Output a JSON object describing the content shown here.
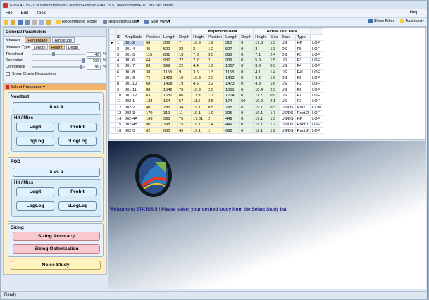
{
  "window": {
    "title": "ESSTATUS - C:\\Users\\mmarvast\\Desktop\\Eclipse\\STATUS 5 Development\\Full Data Set.status"
  },
  "menu": {
    "items": [
      "File",
      "Edit",
      "Tools"
    ],
    "help": "Help"
  },
  "toolbar": {
    "recommend": "Recommend Model",
    "inspection": "Inspection Data",
    "split": "Split View",
    "show_filter": "Show Filter",
    "assistant": "Assistant"
  },
  "general": {
    "title": "General Parameters",
    "measure_label": "Measure",
    "measure_tabs": [
      "Percentage",
      "Amplitude"
    ],
    "measure_type_label": "Measure Type",
    "measure_types": [
      "Length",
      "Height",
      "Depth"
    ],
    "threshold_label": "Threshold",
    "threshold_value": "40",
    "saturation_label": "Saturation",
    "saturation_value": "100",
    "confidence_label": "Confidence",
    "confidence_value": "95",
    "percent": "%",
    "show_charts": "Show Charts Descriptions",
    "threshold_level": 0.4,
    "saturation_level": 1.0,
    "confidence_level": 0.95
  },
  "processor": {
    "header": "Select Processor",
    "nordtest": "Nordtest",
    "ahat": "â vs a",
    "hitmiss": "Hit / Miss",
    "logit": "Logit",
    "probit": "Probit",
    "loglog": "LogLog",
    "cloglog": "cLogLog",
    "pod": "POD",
    "sizing": "Sizing",
    "sizing_accuracy": "Sizing Accuracy",
    "sizing_optimization": "Sizing Optimization",
    "noise": "Noise Study"
  },
  "grid": {
    "group_headers": [
      "Inspection Data",
      "Actual Test Data"
    ],
    "columns": [
      "ID",
      "Amplitude",
      "Position",
      "Length",
      "Depth",
      "Height",
      "Position",
      "Length",
      "Depth",
      "Height",
      "Side",
      "Zone",
      "Type"
    ],
    "rows": [
      [
        "1",
        "J01-2",
        "68",
        "306",
        "7",
        "16.9",
        "1.2",
        "310",
        "0",
        "17.8",
        "1.3",
        "US",
        "HP",
        "LOF"
      ],
      [
        "2",
        "J01-4",
        "45",
        "520",
        "22",
        "3",
        "1.2",
        "527",
        "0",
        "3",
        "1.3",
        "DS",
        "F5",
        "LOF"
      ],
      [
        "3",
        "J01-5",
        "115",
        "881",
        "13",
        "7.8",
        "3.5",
        "888",
        "0",
        "7.1",
        "2.4",
        "DS",
        "F3",
        "LOF"
      ],
      [
        "4",
        "J01-6",
        "64",
        "932",
        "27",
        "7.2",
        "2",
        "939",
        "0",
        "5.9",
        "1.5",
        "US",
        "F3",
        "LOF"
      ],
      [
        "5",
        "J01-7",
        "83",
        "999",
        "22",
        "4.4",
        "1.9",
        "1007",
        "0",
        "3.9",
        "0.3",
        "US",
        "F4",
        "LOF"
      ],
      [
        "6",
        "J01-8",
        "38",
        "1153",
        "9",
        "3.5",
        "1.3",
        "1158",
        "0",
        "4.1",
        "1.4",
        "US",
        "F4U",
        "LOF"
      ],
      [
        "7",
        "J01-9",
        "72",
        "1428",
        "10",
        "10.9",
        "2.5",
        "1433",
        "0",
        "9.2",
        "1.6",
        "DS",
        "F2",
        "LOF"
      ],
      [
        "8",
        "J01-10",
        "68",
        "1468",
        "19",
        "4.5",
        "2.2",
        "1473",
        "0",
        "4.3",
        "1.6",
        "DS",
        "F2",
        "LOF"
      ],
      [
        "9",
        "J01-11",
        "88",
        "1542",
        "76",
        "10.9",
        "2.5",
        "1551",
        "0",
        "10.4",
        "2.3",
        "US",
        "F2",
        "LOF"
      ],
      [
        "10",
        "J01-12",
        "63",
        "1631",
        "86",
        "11.9",
        "1.7",
        "1714",
        "0",
        "11.7",
        "0.9",
        "US",
        "F1",
        "LOF"
      ],
      [
        "11",
        "J02-1",
        "138",
        "164",
        "57",
        "11.6",
        "2.5",
        "174",
        "50",
        "10.9",
        "2.1",
        "US",
        "F2",
        "LOF"
      ],
      [
        "12",
        "J02-2",
        "40",
        "285",
        "34",
        "19.1",
        "0.5",
        "295",
        "0",
        "19.1",
        "0.3",
        "US/DS",
        "RM2",
        "CON"
      ],
      [
        "13",
        "J02-3",
        "170",
        "319",
        "11",
        "19.1",
        "1.9",
        "325",
        "0",
        "19.1",
        "1.7",
        "US/DS",
        "Root 2",
        "LOF"
      ],
      [
        "14",
        "J02-4A",
        "106",
        "398",
        "75",
        "17.01",
        "2",
        "449",
        "0",
        "17.1",
        "1.3",
        "US/DS",
        "HP",
        "LOF"
      ],
      [
        "15",
        "J02-4B",
        "90",
        "398",
        "75",
        "19.1",
        "1.4",
        "449",
        "0",
        "19.1",
        "1.2",
        "US/DS",
        "Root 1",
        "LOF"
      ],
      [
        "16",
        "J02-5",
        "62",
        "660",
        "45",
        "19.1",
        "1",
        "698",
        "0",
        "19.1",
        "1.2",
        "US/DS",
        "Root 2",
        "LOF"
      ]
    ]
  },
  "splash": {
    "welcome": "Welcome to STATUS 5 ! Please select your desired study from the Select Study list."
  },
  "status": {
    "text": "Ready"
  }
}
